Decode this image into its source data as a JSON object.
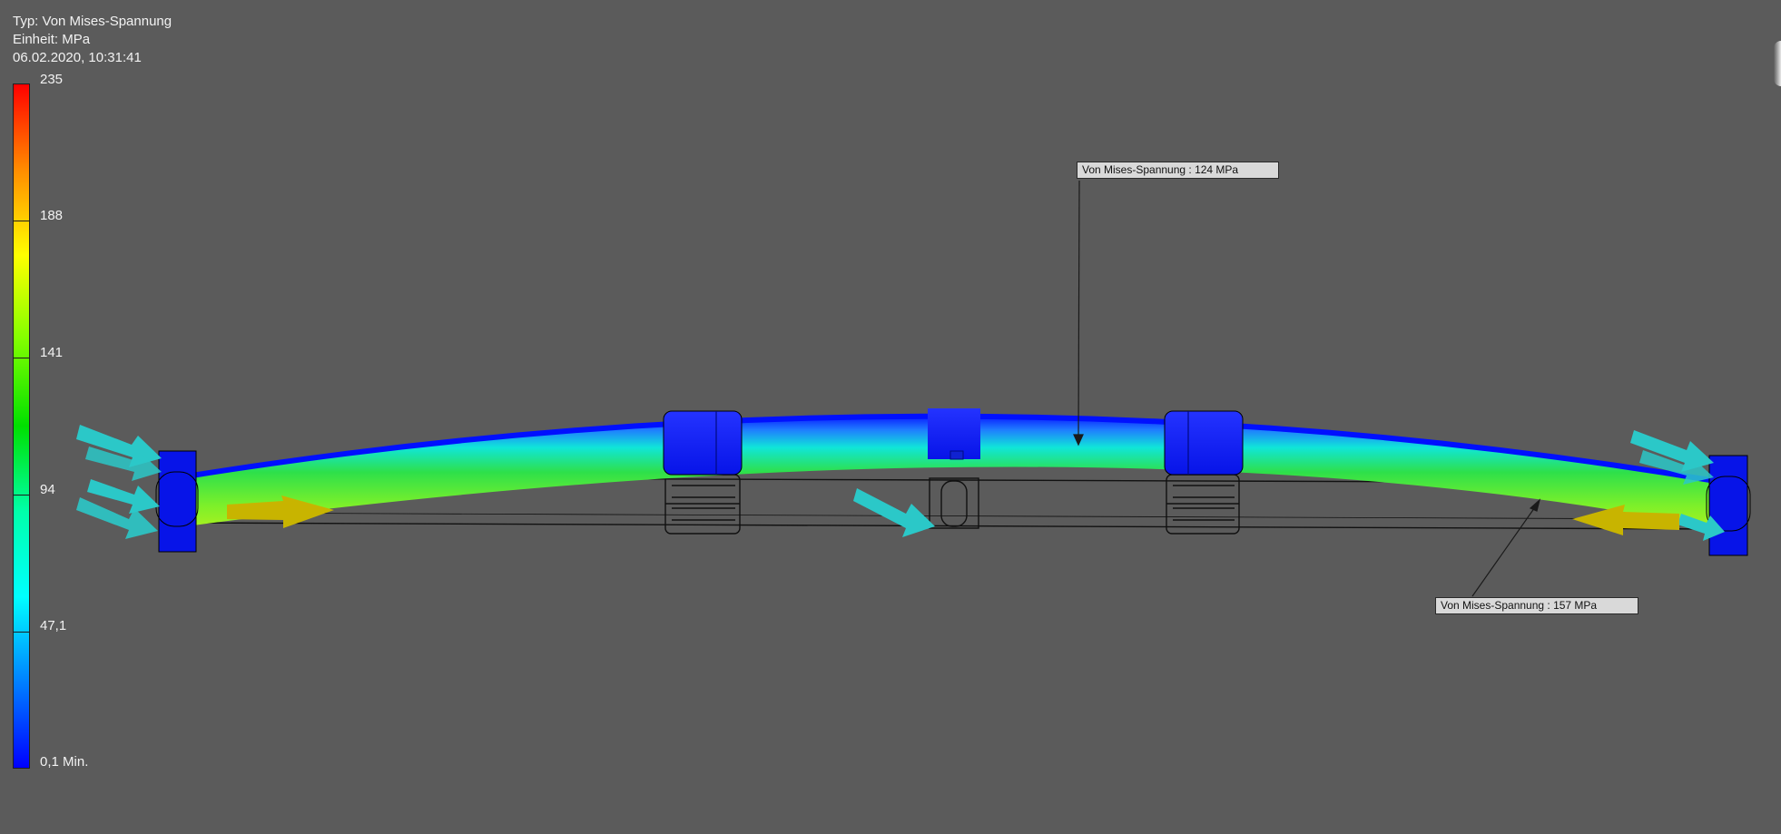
{
  "result_info": {
    "type_line": "Typ: Von Mises-Spannung",
    "unit_line": "Einheit: MPa",
    "timestamp_line": "06.02.2020, 10:31:41"
  },
  "legend": {
    "labels": [
      "235",
      "188",
      "141",
      "94",
      "47,1",
      "0,1 Min."
    ],
    "colors": [
      "#ff0000",
      "#ff8c00",
      "#ffff00",
      "#80ff00",
      "#00e000",
      "#00ffaa",
      "#00ffff",
      "#0080ff",
      "#0000ff"
    ]
  },
  "probes": [
    {
      "label": "Von Mises-Spannung : 124 MPa",
      "value": 124
    },
    {
      "label": "Von Mises-Spannung : 157 MPa",
      "value": 157
    }
  ],
  "colors": {
    "background": "#5b5b5b",
    "part_blue": "#0a1dff",
    "load_arrow": "#2bc8c8",
    "constraint_arrow": "#c8b400",
    "callout_bg": "#d9d9d9"
  },
  "icons": {
    "load": "cyan-force-arrow-icon",
    "constraint": "yellow-fixed-constraint-arrow-icon"
  }
}
